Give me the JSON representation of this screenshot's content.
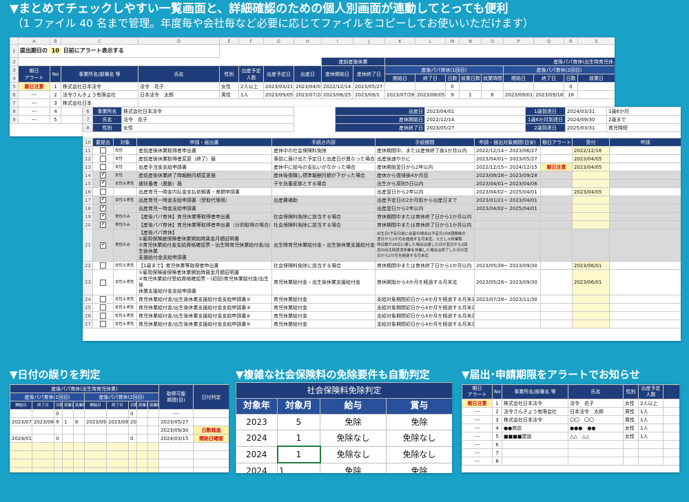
{
  "headline": {
    "line1": "▼まとめてチェックしやすい一覧画面と、詳細確認のための個人別画面が連動してとっても便利",
    "line2": "（1 ファイル 40 名まで管理。年度毎や会社毎など必要に応じてファイルをコピーしてお使いいただけます）"
  },
  "sheet1": {
    "cols": [
      "A",
      "B",
      "C",
      "D",
      "E",
      "F",
      "G",
      "H",
      "I",
      "J",
      "K",
      "L",
      "M",
      "N",
      "O",
      "P",
      "Q",
      "R",
      "S"
    ],
    "alert_label": "提出期日の",
    "alert_days": "10",
    "alert_suffix": "日前にアラート表示する",
    "h_san": "産前産後休業",
    "h_papa_main": "産後パパ育休(出生時育児休",
    "h_papa1": "産後パパ育休(1回目)",
    "h_papa2": "産後パパ育休(2回目)",
    "h_kijitsu": "期日\nアラート",
    "h_no": "No",
    "h_office": "事業所名/部署名 等",
    "h_name": "氏名",
    "h_sex": "性別",
    "h_yotei_nin": "出産予定\n人数",
    "h_yotei_bi": "出産予定日",
    "h_shussan": "出産日",
    "h_kyugyo_start": "産休開始日",
    "h_kyugyo_end": "産休終了日",
    "h_start": "開始日",
    "h_end": "終了日",
    "h_days": "日数",
    "h_workdays": "就業日数",
    "h_worktime": "就業時間",
    "h_start2": "開始日",
    "h_end2": "終了日",
    "h_days2": "日数",
    "h_workdays2": "就業日",
    "row5": {
      "alert": "期日注意",
      "no": "1",
      "office": "株式会社日本法令",
      "name": "法令　花子",
      "sex": "女性",
      "nin": "2人以上",
      "yotei": "2023/03/21",
      "shussan": "2023/04/01",
      "ks": "2022/12/14",
      "ke": "2023/05/27",
      "zero": "0",
      "zero2": "0"
    },
    "row6": {
      "alert": "---",
      "no": "2",
      "office": "法令さんきょう有限会社",
      "name": "日本法令　太郎",
      "sex": "男性",
      "nin": "1人",
      "yotei": "2023/09/05",
      "shussan": "2023/07/28",
      "ks": "2023/06/25",
      "ke": "2023/09/1",
      "s": "2023/07/28",
      "e": "2023/08/05",
      "d": "9",
      "w": "1",
      "t": "6",
      "s2": "2023/09/01",
      "e2": "2023/09/18",
      "d2": "18"
    },
    "row7": {
      "alert": "---",
      "no": "3",
      "office": "株式会社日本"
    },
    "row8": {
      "alert": "---",
      "no": "4"
    },
    "row9": {
      "alert": "---",
      "no": "5"
    }
  },
  "sheet2": {
    "info": {
      "office_label": "事業所名",
      "office": "株式会社日本法令",
      "name_label": "氏名",
      "name": "法令　花子",
      "sex_label": "性別",
      "sex": "女性",
      "birth_label": "出産日",
      "birth": "2023/04/01",
      "ks_label": "産休開始日",
      "ks": "2022/12/14",
      "ke_label": "産休終了日",
      "ke": "2023/05/27",
      "b1_label": "1歳到達日",
      "b1": "2024/03/31",
      "b16_label": "1歳6か月到達日",
      "b16": "2024/09/30",
      "b2_label": "2歳到達日",
      "b2": "2025/03/31",
      "r1": "1歳6か月",
      "r2": "2歳まで",
      "r3": "育児時短"
    },
    "headers": {
      "c1": "要提出",
      "c2": "対象",
      "c3": "申請・届出書",
      "c4": "手続き内容",
      "c5": "手続期間",
      "c6": "申請・届出対象期間(目安)",
      "c7": "期日アラート",
      "c8": "受付",
      "c9": "申請"
    },
    "rows": [
      {
        "rn": "11",
        "check": "",
        "target": "女性",
        "doc": "産前産後休業取得者申出書",
        "content": "産休中の社会保険料免除",
        "period": "産休期間中、または産休終了後1か月以内",
        "range": "2022/12/14~ 2023/06/27",
        "alert": "",
        "recv": "2022/12/16",
        "grey": false
      },
      {
        "rn": "12",
        "check": "",
        "target": "女性",
        "doc": "産前産後休業取得者変更（終了）届",
        "content": "事前に届け出た予定日と出産日が異なった場合",
        "period": "出産後速やかに",
        "range": "2023/04/01~ 2023/05/27",
        "alert": "",
        "recv": "2023/04/05",
        "grey": false
      },
      {
        "rn": "13",
        "check": "",
        "target": "女性",
        "doc": "出産手当金支給申請書",
        "content": "産休中に給与の支払いがなかった場合",
        "period": "産休開始翌日から2年以内",
        "range": "2022/12/15~ 2024/12/15",
        "alert": "期日注意",
        "recv": "2023/04/05",
        "grey": false
      },
      {
        "rn": "14",
        "check": "✔",
        "target": "女性",
        "doc": "産前産後休業終了時報酬月額変更届",
        "content": "産休後復職し標準報酬月額が下がった場合",
        "period": "産休から復帰後4か月目",
        "range": "2023/08/28~ 2023/09/28",
        "alert": "",
        "recv": "",
        "grey": true
      },
      {
        "rn": "15",
        "check": "✔",
        "target": "女性＆男性",
        "doc": "被扶養者（異動）届",
        "content": "子を扶養家族とする場合",
        "period": "出生から原則5日以内",
        "range": "2023/04/01~ 2023/04/06",
        "alert": "",
        "recv": "",
        "grey": true
      },
      {
        "rn": "16",
        "check": "",
        "target": "",
        "doc": "出産育児一時金内払金支払依頼書・差額申請書",
        "content": "",
        "period": "出産翌日から2年以内",
        "range": "2023/04/02~ 2025/04/01",
        "alert": "",
        "recv": "2023/04/05",
        "grey": false
      },
      {
        "rn": "17",
        "check": "✔",
        "target": "女性＆男性",
        "doc": "出産育児一時金支給申請書（受取代理用）",
        "content": "出産費補助",
        "period": "出産予定日の2か月前から出産日まで",
        "range": "2023/01/21~ 2023/04/01",
        "alert": "",
        "recv": "",
        "grey": true
      },
      {
        "rn": "18",
        "check": "✔",
        "target": "",
        "doc": "出産育児一時金支給申請書",
        "content": "",
        "period": "出産翌日から2年以内",
        "range": "2023/04/02~ 2025/04/01",
        "alert": "",
        "recv": "",
        "grey": true
      },
      {
        "rn": "19",
        "check": "✔",
        "target": "男性のみ",
        "doc": "【産後パパ育休】育児休業等取得者申出書",
        "content": "社会保険料免除に該当する場合",
        "period": "育休期間中または育休終了日から1か月以内",
        "range": "",
        "alert": "",
        "recv": "",
        "grey": true
      },
      {
        "rn": "20",
        "check": "✔",
        "target": "男性のみ",
        "doc": "【産後パパ育休】育児休業等取得者申出書（分割取得の場合）",
        "content": "社会保険料免除に該当する場合",
        "period": "育休期間中または育休終了日から1か月以内",
        "range": "",
        "alert": "",
        "recv": "",
        "grey": true
      },
      {
        "rn": "22",
        "check": "",
        "target": "女性＆男性",
        "doc": "【1歳まで】育児休業等取得者申出書",
        "content": "社会保険料免除に該当する場合",
        "period": "育休期間中または育休終了日から1か月以内",
        "range": "2023/05/28~ 2023/09/30",
        "alert": "",
        "recv": "2023/06/01",
        "grey": false
      },
      {
        "rn": "24",
        "check": "",
        "target": "女性＆男性",
        "doc": "育児休業給付金/出生後休業支援給付金支給申請書②",
        "content": "育児休業給付金",
        "period": "支給対象期間初日から4か月を経過する月末迄",
        "range": "2023/07/28~ 2023/11/30",
        "alert": "",
        "recv": "",
        "grey": false
      },
      {
        "rn": "25",
        "check": "",
        "target": "女性＆男性",
        "doc": "育児休業給付金/出生後休業支援給付金支給申請書③",
        "content": "育児休業給付金",
        "period": "支給対象期間初日から4か月を経過する月末迄",
        "range": "",
        "alert": "",
        "recv": "",
        "grey": false
      },
      {
        "rn": "26",
        "check": "",
        "target": "女性＆男性",
        "doc": "育児休業給付金/出生後休業支援給付金支給申請書④",
        "content": "育児休業給付金",
        "period": "支給対象期間初日から4か月を経過する月末迄",
        "range": "",
        "alert": "",
        "recv": "",
        "grey": false
      },
      {
        "rn": "27",
        "check": "",
        "target": "女性＆男性",
        "doc": "育児休業給付金/出生後休業支援給付金支給申請書⑤",
        "content": "育児休業給付金",
        "period": "支給対象期間初日から4か月を経過する月末迄",
        "range": "",
        "alert": "",
        "recv": "",
        "grey": false
      }
    ],
    "row21": {
      "rn": "21",
      "check": "✔",
      "target": "男性のみ",
      "doc1": "【産後パパ育休】",
      "doc2": "①雇用保険被保険者休業開始時賃金月額証明書",
      "doc3": "②育児休業給付金支給資格確認票・出生時育児休業給付金/出生後休業",
      "doc4": "支援給付金支給申請書",
      "content": "出生時育児休業給付金・出生後休業支援給付金",
      "period1": "出生日(予定日前に出産の場合は予定日)の8週間後の",
      "period2": "翌日から2か月を経過する月末迄。ただし②休業取",
      "period3": "得日数が28日に達した場合は達した日の翌日から2回",
      "period4": "目の出生時育児休業を休業した場合は終了した日の翌",
      "period5": "日から2か月を経過する月末迄"
    },
    "row23": {
      "rn": "23",
      "check": "",
      "target": "女性＆男性",
      "doc1": "①雇用保険被保険者休業開始時賃金月額証明書",
      "doc2": "②育児休業給付受給資格確認票・(初回)育児休業給付金/出生後",
      "doc3": "休業支援給付金支給申請書",
      "content": "育児休業給付金・出生後休業支援給付金",
      "period": "育休開始から4か月を経過する月末迄",
      "range": "2023/05/28~ 2023/09/30",
      "recv": "2023/06/01"
    }
  },
  "panel1": {
    "title": "▼日付の誤りを判定",
    "h_main": "産後パパ育休(出生時育児休業)",
    "h1": "産後パパ育休(1回目)",
    "h2": "産後パパ育休(2回目)",
    "h_kanou": "取得可能\n期間(目)",
    "h_check": "日付判定",
    "sub": [
      "開始日",
      "終了日",
      "日数",
      "就業日数",
      "就業時間",
      "開始日",
      "終了日",
      "日数",
      "就業日数",
      "就業時間"
    ],
    "r1": {
      "d": "0",
      "d2": "0",
      "k": "---"
    },
    "r2": {
      "s": "2023/07/28",
      "e": "2023/08/05",
      "d": "9",
      "w": "1",
      "t": "6",
      "s2": "2023/09/01",
      "e2": "2023/09/20",
      "d2": "20",
      "k": "2023/05/27",
      "msg": ""
    },
    "r3": {
      "k": "2023/09/30",
      "msg": "日数超過"
    },
    "r4": {
      "s": "2024/01/15",
      "d": "0",
      "d2": "0",
      "k": "2024/03/15",
      "msg": "開始日確認"
    }
  },
  "panel2": {
    "title": "▼複雑な社会保険料の免除要件も自動判定",
    "header": "社会保険料免除判定",
    "cols": [
      "対象年",
      "対象月",
      "給与",
      "賞与"
    ],
    "rows": [
      {
        "year": "2023",
        "month": "5",
        "salary": "免除",
        "bonus": "免除"
      },
      {
        "year": "2024",
        "month": "1",
        "salary": "免除なし",
        "bonus": "免除なし"
      },
      {
        "year": "2024",
        "month": "1",
        "salary": "免除なし",
        "bonus": "免除なし"
      },
      {
        "year": "2024",
        "month": "1",
        "salary": "免除",
        "bonus": "免除"
      }
    ]
  },
  "panel3": {
    "title": "▼届出･申請期限をアラートでお知らせ",
    "cols": [
      "期日\nアラート",
      "No",
      "事業所名/部署名 等",
      "氏名",
      "性別",
      "出産予定\n人数"
    ],
    "rows": [
      {
        "alert": "期日注意",
        "no": "1",
        "office": "株式会社日本法令",
        "name": "法令　花子",
        "sex": "女性",
        "nin": "2人以上"
      },
      {
        "alert": "---",
        "no": "2",
        "office": "法令さんきょう有限会社",
        "name": "日本法令　太郎",
        "sex": "男性",
        "nin": "1人"
      },
      {
        "alert": "---",
        "no": "3",
        "office": "株式会社日本法令",
        "name": "〇〇　〇〇",
        "sex": "男性",
        "nin": "1人"
      },
      {
        "alert": "---",
        "no": "4",
        "office": "●●商店",
        "name": "●●●　●●",
        "sex": "女性",
        "nin": "1人"
      },
      {
        "alert": "---",
        "no": "5",
        "office": "■■■■建設",
        "name": "△△　△△",
        "sex": "女性",
        "nin": "1人"
      },
      {
        "alert": "---",
        "no": "6",
        "office": "",
        "name": "",
        "sex": "",
        "nin": ""
      },
      {
        "alert": "---",
        "no": "7",
        "office": "",
        "name": "",
        "sex": "",
        "nin": ""
      },
      {
        "alert": "---",
        "no": "8",
        "office": "",
        "name": "",
        "sex": "",
        "nin": ""
      }
    ]
  },
  "colors": {
    "bg": "#1aa1c7",
    "navy": "#1f3d7a",
    "alert_yellow": "#fff2a8",
    "alert_red": "#cc0000"
  }
}
